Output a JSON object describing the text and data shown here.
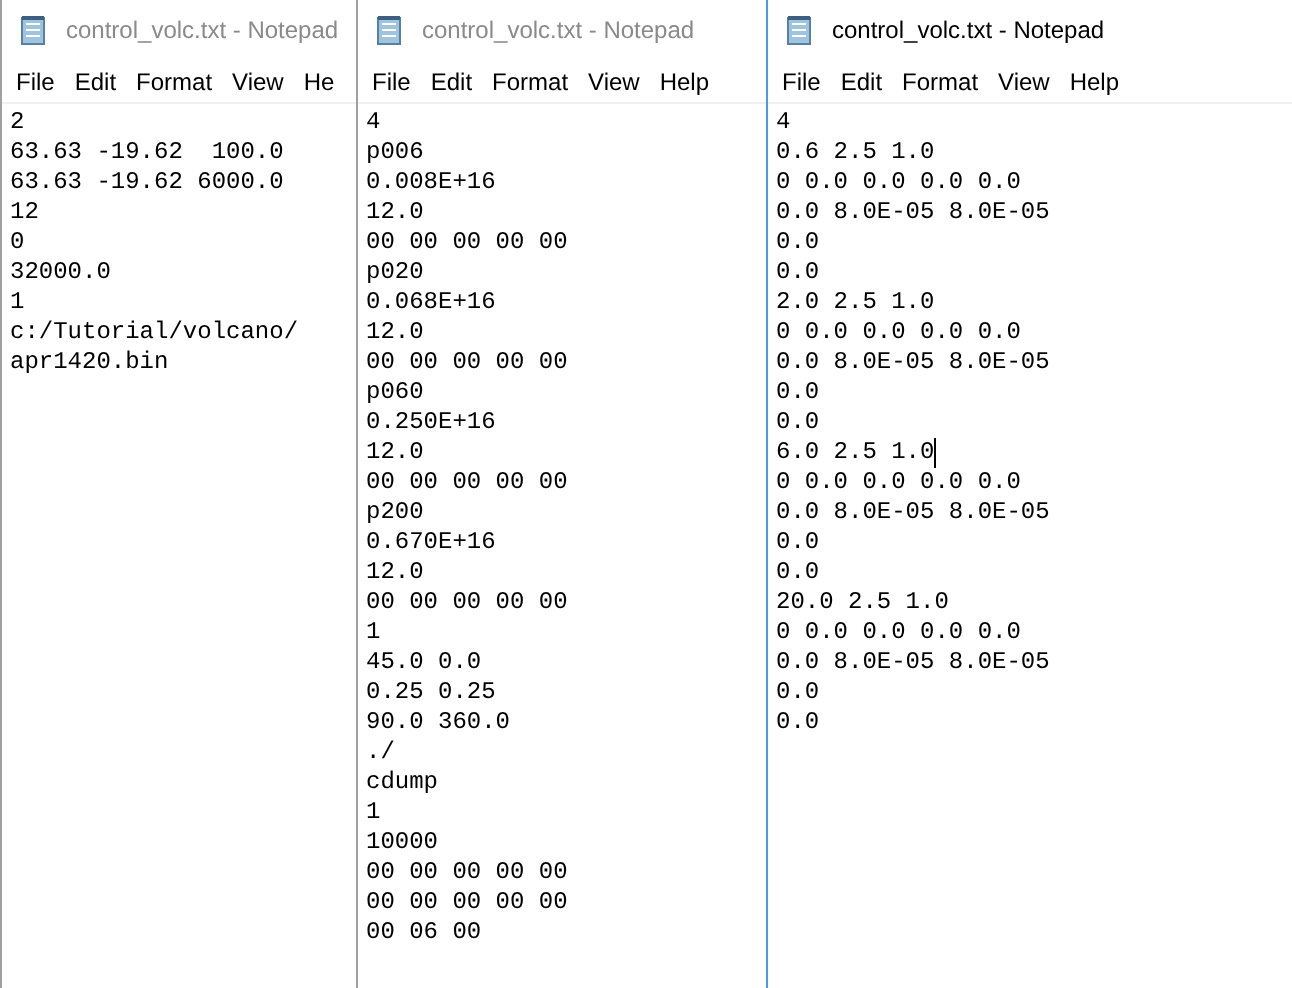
{
  "windows": [
    {
      "title": "control_volc.txt - Notepad",
      "active": false,
      "menu": [
        "File",
        "Edit",
        "Format",
        "View",
        "He"
      ],
      "lines": [
        {
          "text": "2",
          "caret": false
        },
        {
          "text": "63.63 -19.62  100.0",
          "caret": false
        },
        {
          "text": "63.63 -19.62 6000.0",
          "caret": false
        },
        {
          "text": "12",
          "caret": false
        },
        {
          "text": "0",
          "caret": false
        },
        {
          "text": "32000.0",
          "caret": false
        },
        {
          "text": "1",
          "caret": false
        },
        {
          "text": "c:/Tutorial/volcano/",
          "caret": false
        },
        {
          "text": "apr1420.bin",
          "caret": false
        }
      ]
    },
    {
      "title": "control_volc.txt - Notepad",
      "active": false,
      "menu": [
        "File",
        "Edit",
        "Format",
        "View",
        "Help"
      ],
      "lines": [
        {
          "text": "4",
          "caret": false
        },
        {
          "text": "p006",
          "caret": false
        },
        {
          "text": "0.008E+16",
          "caret": false
        },
        {
          "text": "12.0",
          "caret": false
        },
        {
          "text": "00 00 00 00 00",
          "caret": false
        },
        {
          "text": "p020",
          "caret": false
        },
        {
          "text": "0.068E+16",
          "caret": false
        },
        {
          "text": "12.0",
          "caret": false
        },
        {
          "text": "00 00 00 00 00",
          "caret": false
        },
        {
          "text": "p060",
          "caret": false
        },
        {
          "text": "0.250E+16",
          "caret": false
        },
        {
          "text": "12.0",
          "caret": false
        },
        {
          "text": "00 00 00 00 00",
          "caret": false
        },
        {
          "text": "p200",
          "caret": false
        },
        {
          "text": "0.670E+16",
          "caret": false
        },
        {
          "text": "12.0",
          "caret": false
        },
        {
          "text": "00 00 00 00 00",
          "caret": false
        },
        {
          "text": "1",
          "caret": false
        },
        {
          "text": "45.0 0.0",
          "caret": false
        },
        {
          "text": "0.25 0.25",
          "caret": false
        },
        {
          "text": "90.0 360.0",
          "caret": false
        },
        {
          "text": "./",
          "caret": false
        },
        {
          "text": "cdump",
          "caret": false
        },
        {
          "text": "1",
          "caret": false
        },
        {
          "text": "10000",
          "caret": false
        },
        {
          "text": "00 00 00 00 00",
          "caret": false
        },
        {
          "text": "00 00 00 00 00",
          "caret": false
        },
        {
          "text": "00 06 00",
          "caret": false
        }
      ]
    },
    {
      "title": "control_volc.txt - Notepad",
      "active": true,
      "menu": [
        "File",
        "Edit",
        "Format",
        "View",
        "Help"
      ],
      "lines": [
        {
          "text": "4",
          "caret": false
        },
        {
          "text": "0.6 2.5 1.0",
          "caret": false
        },
        {
          "text": "0 0.0 0.0 0.0 0.0",
          "caret": false
        },
        {
          "text": "0.0 8.0E-05 8.0E-05",
          "caret": false
        },
        {
          "text": "0.0",
          "caret": false
        },
        {
          "text": "0.0",
          "caret": false
        },
        {
          "text": "2.0 2.5 1.0",
          "caret": false
        },
        {
          "text": "0 0.0 0.0 0.0 0.0",
          "caret": false
        },
        {
          "text": "0.0 8.0E-05 8.0E-05",
          "caret": false
        },
        {
          "text": "0.0",
          "caret": false
        },
        {
          "text": "0.0",
          "caret": false
        },
        {
          "text": "6.0 2.5 1.0",
          "caret": true
        },
        {
          "text": "0 0.0 0.0 0.0 0.0",
          "caret": false
        },
        {
          "text": "0.0 8.0E-05 8.0E-05",
          "caret": false
        },
        {
          "text": "0.0",
          "caret": false
        },
        {
          "text": "0.0",
          "caret": false
        },
        {
          "text": "20.0 2.5 1.0",
          "caret": false
        },
        {
          "text": "0 0.0 0.0 0.0 0.0",
          "caret": false
        },
        {
          "text": "0.0 8.0E-05 8.0E-05",
          "caret": false
        },
        {
          "text": "0.0",
          "caret": false
        },
        {
          "text": "0.0",
          "caret": false
        }
      ]
    }
  ]
}
